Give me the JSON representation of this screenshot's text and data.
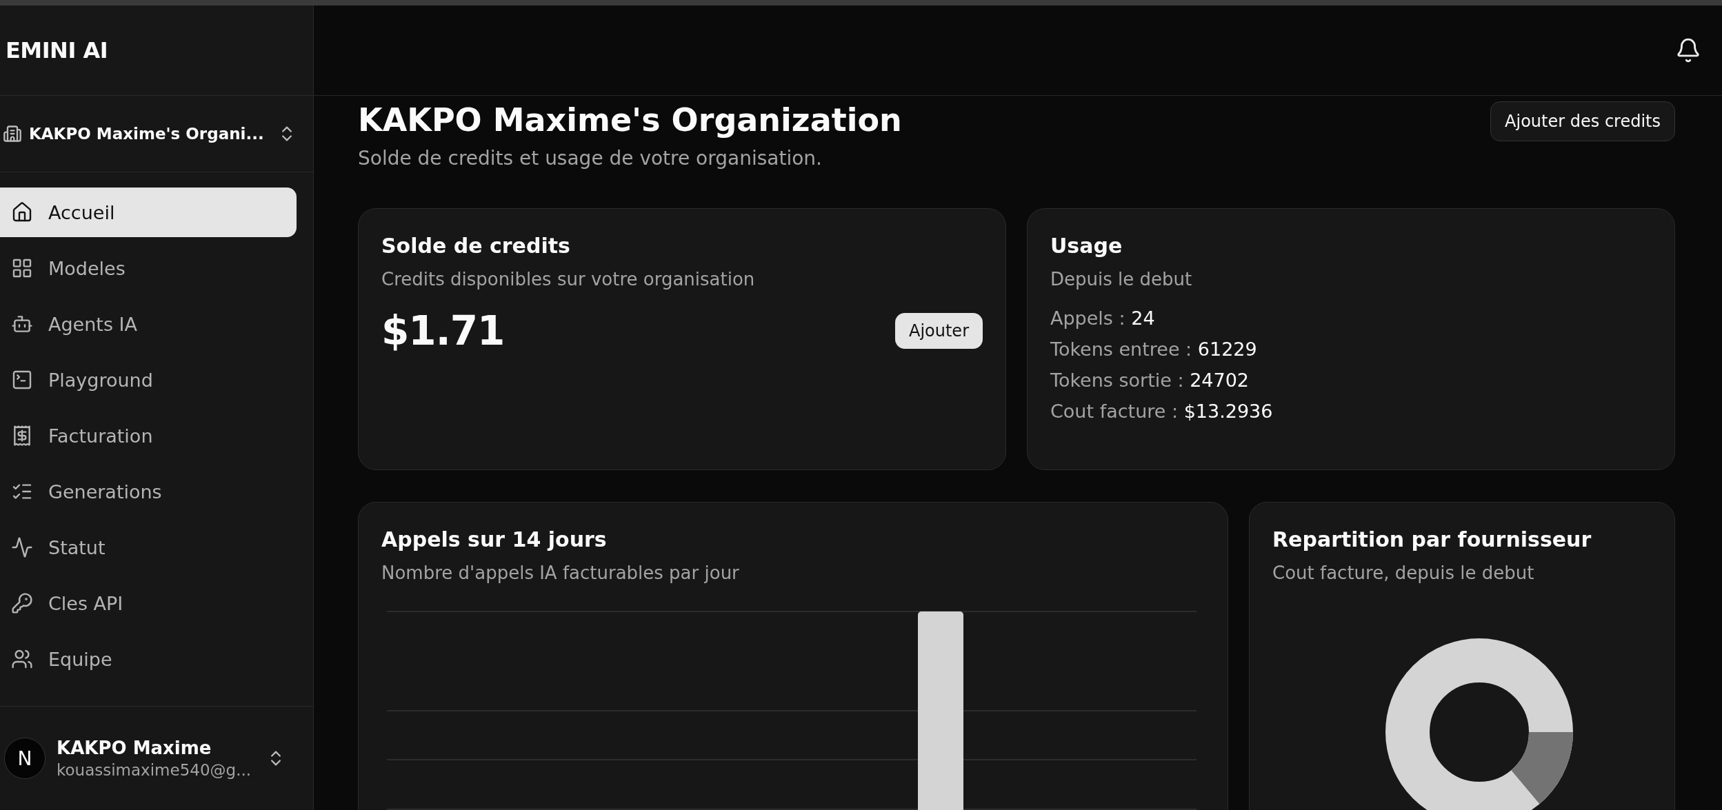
{
  "sidebar": {
    "logo": "EMINI AI",
    "organization": "KAKPO Maxime's Organi...",
    "items": [
      {
        "label": "Accueil",
        "kind": "home",
        "selected": true
      },
      {
        "label": "Modeles",
        "kind": "models",
        "selected": false
      },
      {
        "label": "Agents IA",
        "kind": "agents",
        "selected": false
      },
      {
        "label": "Playground",
        "kind": "playground",
        "selected": false
      },
      {
        "label": "Facturation",
        "kind": "billing",
        "selected": false
      },
      {
        "label": "Generations",
        "kind": "generations",
        "selected": false
      },
      {
        "label": "Statut",
        "kind": "status",
        "selected": false
      },
      {
        "label": "Cles API",
        "kind": "keys",
        "selected": false
      },
      {
        "label": "Equipe",
        "kind": "team",
        "selected": false
      }
    ],
    "user": {
      "avatar": "N",
      "name": "KAKPO Maxime",
      "email": "kouassimaxime540@g..."
    }
  },
  "page": {
    "title": "KAKPO Maxime's Organization",
    "subtitle": "Solde de credits et usage de votre organisation.",
    "action": "Ajouter des credits"
  },
  "credits": {
    "title": "Solde de credits",
    "subtitle": "Credits disponibles sur votre organisation",
    "amount": "$1.71",
    "button": "Ajouter"
  },
  "usage": {
    "title": "Usage",
    "subtitle": "Depuis le debut",
    "stats": [
      {
        "label": "Appels :",
        "value": "24"
      },
      {
        "label": "Tokens entree :",
        "value": "61229"
      },
      {
        "label": "Tokens sortie :",
        "value": "24702"
      },
      {
        "label": "Cout facture :",
        "value": "$13.2936"
      }
    ]
  },
  "calls_chart": {
    "title": "Appels sur 14 jours",
    "subtitle": "Nombre d'appels IA facturables par jour"
  },
  "provider_chart": {
    "title": "Repartition par fournisseur",
    "subtitle": "Cout facture, depuis le debut"
  }
}
